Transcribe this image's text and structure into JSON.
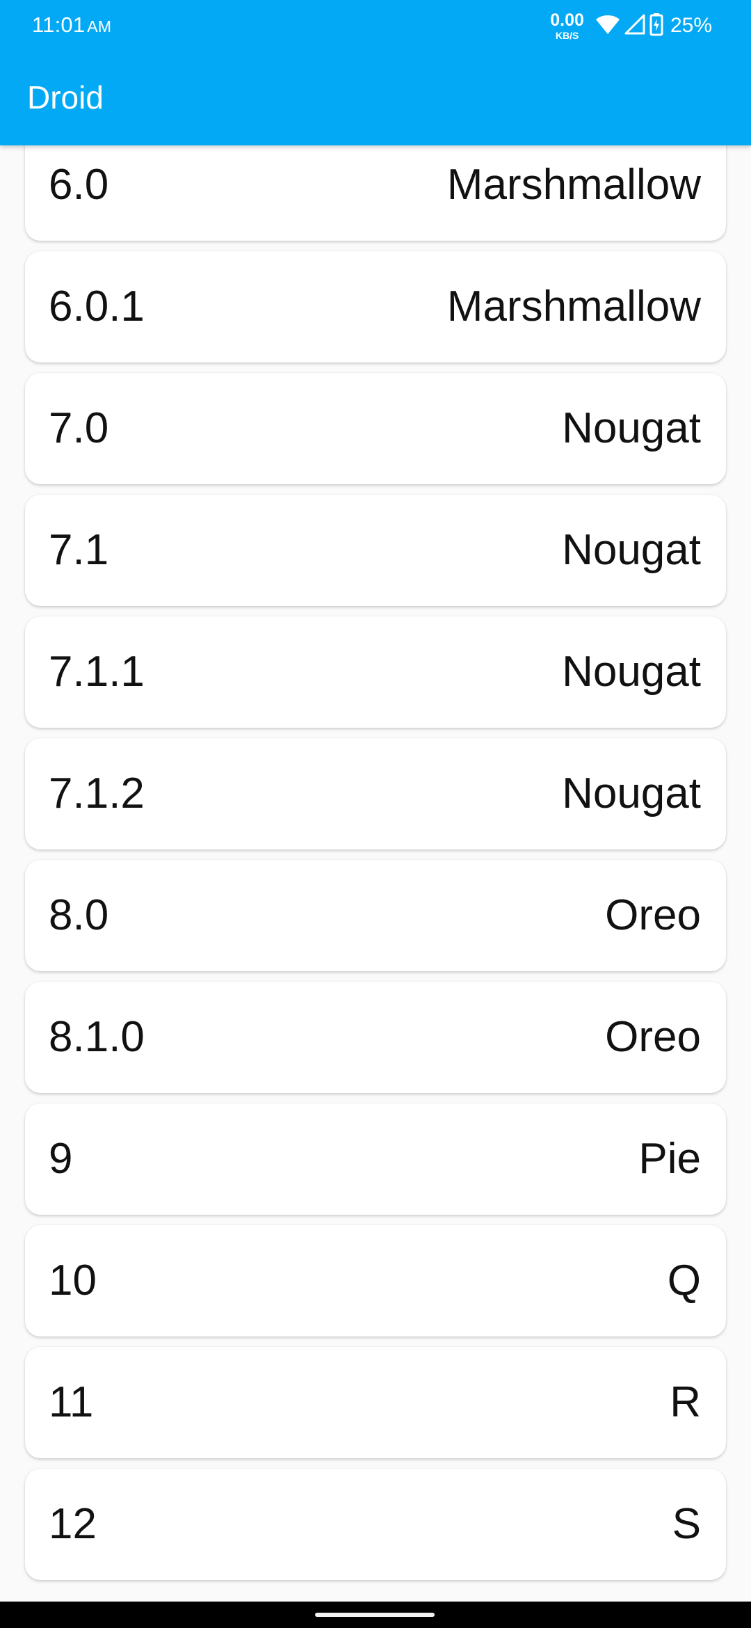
{
  "status_bar": {
    "time": "11:01",
    "ampm": "AM",
    "net_speed": "0.00",
    "net_unit": "KB/S",
    "battery": "25%"
  },
  "app_bar": {
    "title": "Droid",
    "color": "#03a9f4"
  },
  "versions": [
    {
      "version": "6.0",
      "codename": "Marshmallow"
    },
    {
      "version": "6.0.1",
      "codename": "Marshmallow"
    },
    {
      "version": "7.0",
      "codename": "Nougat"
    },
    {
      "version": "7.1",
      "codename": "Nougat"
    },
    {
      "version": "7.1.1",
      "codename": "Nougat"
    },
    {
      "version": "7.1.2",
      "codename": "Nougat"
    },
    {
      "version": "8.0",
      "codename": "Oreo"
    },
    {
      "version": "8.1.0",
      "codename": "Oreo"
    },
    {
      "version": "9",
      "codename": "Pie"
    },
    {
      "version": "10",
      "codename": "Q"
    },
    {
      "version": "11",
      "codename": "R"
    },
    {
      "version": "12",
      "codename": "S"
    }
  ]
}
